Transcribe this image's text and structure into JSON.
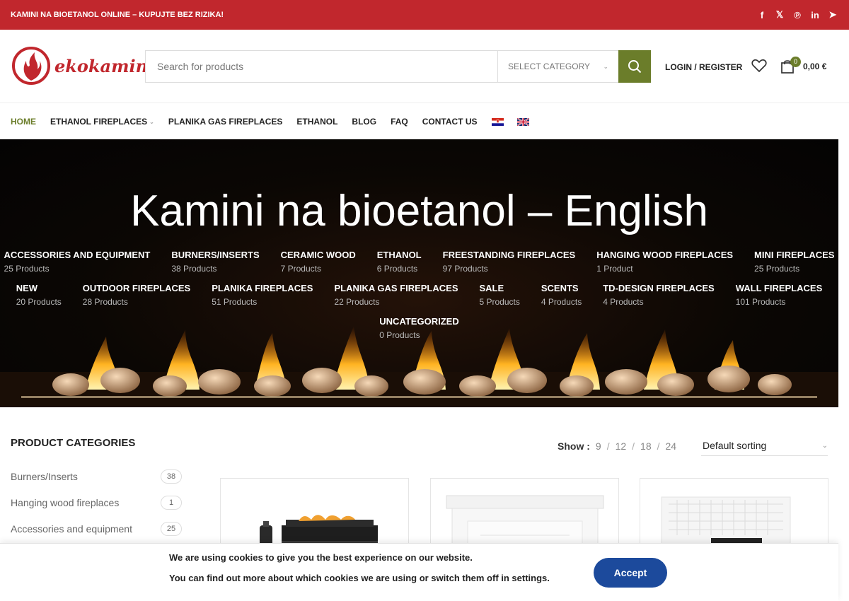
{
  "topbar": {
    "promo": "KAMINI NA BIOETANOL ONLINE – KUPUJTE BEZ RIZIKA!",
    "social": [
      {
        "icon": "facebook-icon",
        "glyph": "f"
      },
      {
        "icon": "x-icon",
        "glyph": "𝕏"
      },
      {
        "icon": "pinterest-icon",
        "glyph": "℗"
      },
      {
        "icon": "linkedin-icon",
        "glyph": "in"
      },
      {
        "icon": "telegram-icon",
        "glyph": "➤"
      }
    ],
    "color": "#c1272d"
  },
  "header": {
    "logo_text": "ekokamini",
    "search": {
      "placeholder": "Search for products",
      "category": "SELECT CATEGORY"
    },
    "login": "LOGIN / REGISTER",
    "cart": {
      "count": "0",
      "total": "0,00 €"
    },
    "accent": "#6b7d2a"
  },
  "nav": {
    "items": [
      {
        "label": "HOME",
        "active": true
      },
      {
        "label": "ETHANOL FIREPLACES"
      },
      {
        "label": "PLANIKA GAS FIREPLACES"
      },
      {
        "label": "ETHANOL"
      },
      {
        "label": "BLOG"
      },
      {
        "label": "FAQ"
      },
      {
        "label": "CONTACT US"
      }
    ],
    "flags": [
      "croatia-flag-icon",
      "uk-flag-icon"
    ]
  },
  "hero": {
    "title": "Kamini na bioetanol – English",
    "rows": [
      [
        {
          "name": "ACCESSORIES AND EQUIPMENT",
          "count": "25 Products"
        },
        {
          "name": "BURNERS/INSERTS",
          "count": "38 Products"
        },
        {
          "name": "CERAMIC WOOD",
          "count": "7 Products"
        },
        {
          "name": "ETHANOL",
          "count": "6 Products"
        },
        {
          "name": "FREESTANDING FIREPLACES",
          "count": "97 Products"
        },
        {
          "name": "HANGING WOOD FIREPLACES",
          "count": "1 Product"
        },
        {
          "name": "MINI FIREPLACES",
          "count": "25 Products"
        }
      ],
      [
        {
          "name": "NEW",
          "count": "20 Products"
        },
        {
          "name": "OUTDOOR FIREPLACES",
          "count": "28 Products"
        },
        {
          "name": "PLANIKA FIREPLACES",
          "count": "51 Products"
        },
        {
          "name": "PLANIKA GAS FIREPLACES",
          "count": "22 Products"
        },
        {
          "name": "SALE",
          "count": "5 Products"
        },
        {
          "name": "SCENTS",
          "count": "4 Products"
        },
        {
          "name": "TD-DESIGN FIREPLACES",
          "count": "4 Products"
        },
        {
          "name": "WALL FIREPLACES",
          "count": "101 Products"
        }
      ],
      [
        {
          "name": "UNCATEGORIZED",
          "count": "0 Products"
        }
      ]
    ]
  },
  "sidebar": {
    "title": "PRODUCT CATEGORIES",
    "items": [
      {
        "label": "Burners/Inserts",
        "count": "38"
      },
      {
        "label": "Hanging wood fireplaces",
        "count": "1"
      },
      {
        "label": "Accessories and equipment",
        "count": "25"
      }
    ]
  },
  "toolbar": {
    "show_label": "Show :",
    "options": [
      "9",
      "12",
      "18",
      "24"
    ],
    "sorting": "Default sorting"
  },
  "cookie": {
    "line1": "We are using cookies to give you the best experience on our website.",
    "line2": "You can find out more about which cookies we are using or switch them off in settings.",
    "accept": "Accept",
    "button_color": "#1c4a9c"
  }
}
